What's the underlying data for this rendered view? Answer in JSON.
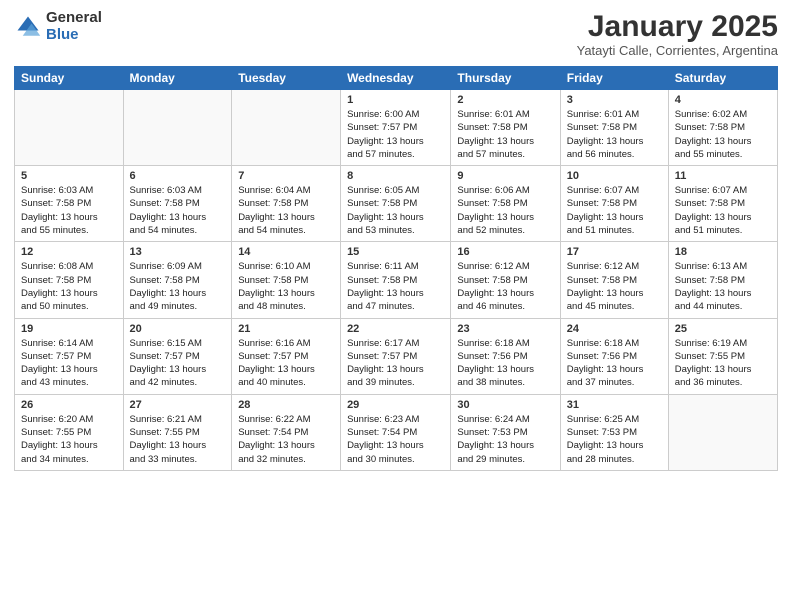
{
  "logo": {
    "general": "General",
    "blue": "Blue"
  },
  "header": {
    "month": "January 2025",
    "location": "Yatayti Calle, Corrientes, Argentina"
  },
  "weekdays": [
    "Sunday",
    "Monday",
    "Tuesday",
    "Wednesday",
    "Thursday",
    "Friday",
    "Saturday"
  ],
  "weeks": [
    [
      {
        "num": "",
        "info": ""
      },
      {
        "num": "",
        "info": ""
      },
      {
        "num": "",
        "info": ""
      },
      {
        "num": "1",
        "info": "Sunrise: 6:00 AM\nSunset: 7:57 PM\nDaylight: 13 hours\nand 57 minutes."
      },
      {
        "num": "2",
        "info": "Sunrise: 6:01 AM\nSunset: 7:58 PM\nDaylight: 13 hours\nand 57 minutes."
      },
      {
        "num": "3",
        "info": "Sunrise: 6:01 AM\nSunset: 7:58 PM\nDaylight: 13 hours\nand 56 minutes."
      },
      {
        "num": "4",
        "info": "Sunrise: 6:02 AM\nSunset: 7:58 PM\nDaylight: 13 hours\nand 55 minutes."
      }
    ],
    [
      {
        "num": "5",
        "info": "Sunrise: 6:03 AM\nSunset: 7:58 PM\nDaylight: 13 hours\nand 55 minutes."
      },
      {
        "num": "6",
        "info": "Sunrise: 6:03 AM\nSunset: 7:58 PM\nDaylight: 13 hours\nand 54 minutes."
      },
      {
        "num": "7",
        "info": "Sunrise: 6:04 AM\nSunset: 7:58 PM\nDaylight: 13 hours\nand 54 minutes."
      },
      {
        "num": "8",
        "info": "Sunrise: 6:05 AM\nSunset: 7:58 PM\nDaylight: 13 hours\nand 53 minutes."
      },
      {
        "num": "9",
        "info": "Sunrise: 6:06 AM\nSunset: 7:58 PM\nDaylight: 13 hours\nand 52 minutes."
      },
      {
        "num": "10",
        "info": "Sunrise: 6:07 AM\nSunset: 7:58 PM\nDaylight: 13 hours\nand 51 minutes."
      },
      {
        "num": "11",
        "info": "Sunrise: 6:07 AM\nSunset: 7:58 PM\nDaylight: 13 hours\nand 51 minutes."
      }
    ],
    [
      {
        "num": "12",
        "info": "Sunrise: 6:08 AM\nSunset: 7:58 PM\nDaylight: 13 hours\nand 50 minutes."
      },
      {
        "num": "13",
        "info": "Sunrise: 6:09 AM\nSunset: 7:58 PM\nDaylight: 13 hours\nand 49 minutes."
      },
      {
        "num": "14",
        "info": "Sunrise: 6:10 AM\nSunset: 7:58 PM\nDaylight: 13 hours\nand 48 minutes."
      },
      {
        "num": "15",
        "info": "Sunrise: 6:11 AM\nSunset: 7:58 PM\nDaylight: 13 hours\nand 47 minutes."
      },
      {
        "num": "16",
        "info": "Sunrise: 6:12 AM\nSunset: 7:58 PM\nDaylight: 13 hours\nand 46 minutes."
      },
      {
        "num": "17",
        "info": "Sunrise: 6:12 AM\nSunset: 7:58 PM\nDaylight: 13 hours\nand 45 minutes."
      },
      {
        "num": "18",
        "info": "Sunrise: 6:13 AM\nSunset: 7:58 PM\nDaylight: 13 hours\nand 44 minutes."
      }
    ],
    [
      {
        "num": "19",
        "info": "Sunrise: 6:14 AM\nSunset: 7:57 PM\nDaylight: 13 hours\nand 43 minutes."
      },
      {
        "num": "20",
        "info": "Sunrise: 6:15 AM\nSunset: 7:57 PM\nDaylight: 13 hours\nand 42 minutes."
      },
      {
        "num": "21",
        "info": "Sunrise: 6:16 AM\nSunset: 7:57 PM\nDaylight: 13 hours\nand 40 minutes."
      },
      {
        "num": "22",
        "info": "Sunrise: 6:17 AM\nSunset: 7:57 PM\nDaylight: 13 hours\nand 39 minutes."
      },
      {
        "num": "23",
        "info": "Sunrise: 6:18 AM\nSunset: 7:56 PM\nDaylight: 13 hours\nand 38 minutes."
      },
      {
        "num": "24",
        "info": "Sunrise: 6:18 AM\nSunset: 7:56 PM\nDaylight: 13 hours\nand 37 minutes."
      },
      {
        "num": "25",
        "info": "Sunrise: 6:19 AM\nSunset: 7:55 PM\nDaylight: 13 hours\nand 36 minutes."
      }
    ],
    [
      {
        "num": "26",
        "info": "Sunrise: 6:20 AM\nSunset: 7:55 PM\nDaylight: 13 hours\nand 34 minutes."
      },
      {
        "num": "27",
        "info": "Sunrise: 6:21 AM\nSunset: 7:55 PM\nDaylight: 13 hours\nand 33 minutes."
      },
      {
        "num": "28",
        "info": "Sunrise: 6:22 AM\nSunset: 7:54 PM\nDaylight: 13 hours\nand 32 minutes."
      },
      {
        "num": "29",
        "info": "Sunrise: 6:23 AM\nSunset: 7:54 PM\nDaylight: 13 hours\nand 30 minutes."
      },
      {
        "num": "30",
        "info": "Sunrise: 6:24 AM\nSunset: 7:53 PM\nDaylight: 13 hours\nand 29 minutes."
      },
      {
        "num": "31",
        "info": "Sunrise: 6:25 AM\nSunset: 7:53 PM\nDaylight: 13 hours\nand 28 minutes."
      },
      {
        "num": "",
        "info": ""
      }
    ]
  ]
}
